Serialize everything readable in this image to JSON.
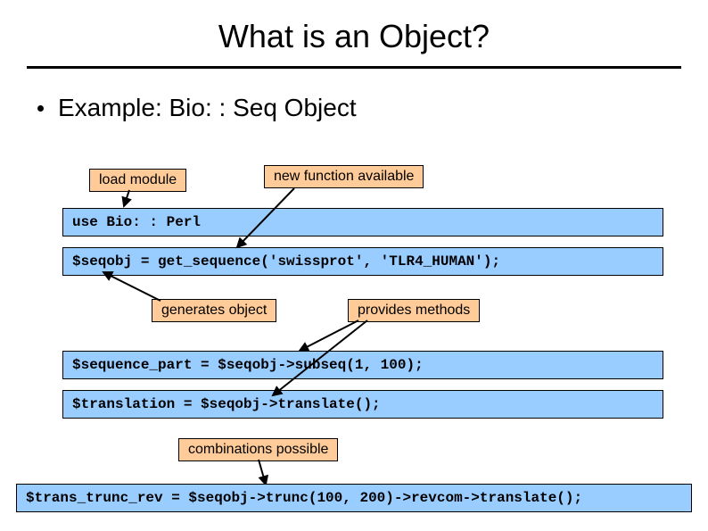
{
  "title": "What is an Object?",
  "bullet": "Example: Bio: : Seq Object",
  "labels": {
    "loadModule": "load module",
    "newFunction": "new function available",
    "generatesObject": "generates object",
    "providesMethods": "provides methods",
    "combinations": "combinations possible"
  },
  "code": {
    "usePerl": "use Bio: : Perl",
    "seqobj": "$seqobj = get_sequence('swissprot', 'TLR4_HUMAN');",
    "sequencePart": "$sequence_part = $seqobj->subseq(1, 100);",
    "translation": "$translation = $seqobj->translate();",
    "transTrunc": "$trans_trunc_rev = $seqobj->trunc(100, 200)->revcom->translate();"
  }
}
